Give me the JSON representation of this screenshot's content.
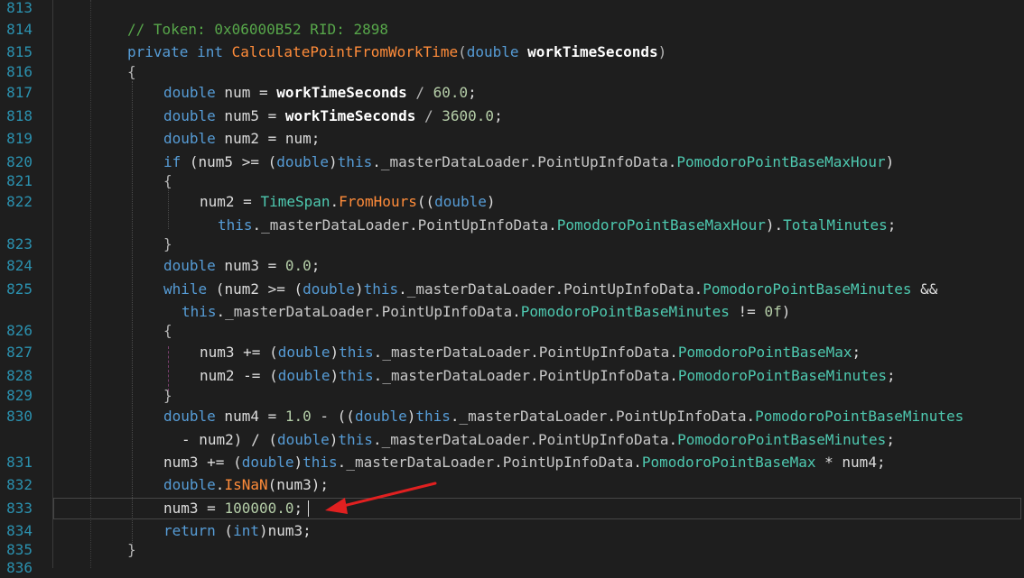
{
  "editor": {
    "line_numbers": [
      "813",
      "814",
      "815",
      "816",
      "817",
      "818",
      "819",
      "820",
      "821",
      "822",
      "823",
      "824",
      "825",
      "826",
      "827",
      "828",
      "829",
      "830",
      "831",
      "832",
      "833",
      "834",
      "835",
      "836"
    ],
    "current_line": "833",
    "colors": {
      "background": "#1e1e1e",
      "line_number": "#2b91af",
      "keyword": "#569cd6",
      "comment": "#57a64a",
      "type": "#4ec9b0",
      "method": "#ff8c3a",
      "annotation_arrow": "#e02020"
    },
    "annotation": {
      "icon": "red-arrow-icon"
    },
    "lines": [
      {
        "tokens": [
          {
            "t": "// Token: 0x06000B52 RID: 2898",
            "c": "cm"
          }
        ]
      },
      {
        "tokens": [
          {
            "t": "private",
            "c": "kw"
          },
          {
            "t": " ",
            "c": ""
          },
          {
            "t": "int",
            "c": "kw"
          },
          {
            "t": " ",
            "c": ""
          },
          {
            "t": "CalculatePointFromWorkTime",
            "c": "fn"
          },
          {
            "t": "(",
            "c": "op"
          },
          {
            "t": "double",
            "c": "kw"
          },
          {
            "t": " ",
            "c": ""
          },
          {
            "t": "workTimeSeconds",
            "c": "pa"
          },
          {
            "t": ")",
            "c": "op"
          }
        ]
      },
      {
        "tokens": [
          {
            "t": "{",
            "c": "op"
          }
        ]
      },
      {
        "tokens": [
          {
            "t": "double",
            "c": "kw"
          },
          {
            "t": " num = ",
            "c": ""
          },
          {
            "t": "workTimeSeconds",
            "c": "pa"
          },
          {
            "t": " / ",
            "c": "op"
          },
          {
            "t": "60.0",
            "c": "nu"
          },
          {
            "t": ";",
            "c": ""
          }
        ]
      },
      {
        "tokens": [
          {
            "t": "double",
            "c": "kw"
          },
          {
            "t": " num5 = ",
            "c": ""
          },
          {
            "t": "workTimeSeconds",
            "c": "pa"
          },
          {
            "t": " / ",
            "c": "op"
          },
          {
            "t": "3600.0",
            "c": "nu"
          },
          {
            "t": ";",
            "c": ""
          }
        ]
      },
      {
        "tokens": [
          {
            "t": "double",
            "c": "kw"
          },
          {
            "t": " num2 = num;",
            "c": ""
          }
        ]
      },
      {
        "tokens": [
          {
            "t": "if",
            "c": "kw"
          },
          {
            "t": " (num5 >= (",
            "c": ""
          },
          {
            "t": "double",
            "c": "kw"
          },
          {
            "t": ")",
            "c": ""
          },
          {
            "t": "this",
            "c": "kw"
          },
          {
            "t": ".",
            "c": ""
          },
          {
            "t": "_masterDataLoader",
            "c": "fd"
          },
          {
            "t": ".",
            "c": ""
          },
          {
            "t": "PointUpInfoData",
            "c": "fd"
          },
          {
            "t": ".",
            "c": ""
          },
          {
            "t": "PomodoroPointBaseMaxHour",
            "c": "pr"
          },
          {
            "t": ")",
            "c": ""
          }
        ]
      },
      {
        "tokens": [
          {
            "t": "{",
            "c": "op"
          }
        ]
      },
      {
        "tokens": [
          {
            "t": "num2 = ",
            "c": ""
          },
          {
            "t": "TimeSpan",
            "c": "ty"
          },
          {
            "t": ".",
            "c": ""
          },
          {
            "t": "FromHours",
            "c": "fn"
          },
          {
            "t": "((",
            "c": ""
          },
          {
            "t": "double",
            "c": "kw"
          },
          {
            "t": ")",
            "c": ""
          }
        ]
      },
      {
        "tokens": [
          {
            "t": "this",
            "c": "kw"
          },
          {
            "t": ".",
            "c": ""
          },
          {
            "t": "_masterDataLoader",
            "c": "fd"
          },
          {
            "t": ".",
            "c": ""
          },
          {
            "t": "PointUpInfoData",
            "c": "fd"
          },
          {
            "t": ".",
            "c": ""
          },
          {
            "t": "PomodoroPointBaseMaxHour",
            "c": "pr"
          },
          {
            "t": ").",
            "c": ""
          },
          {
            "t": "TotalMinutes",
            "c": "pr"
          },
          {
            "t": ";",
            "c": ""
          }
        ]
      },
      {
        "tokens": [
          {
            "t": "}",
            "c": "op"
          }
        ]
      },
      {
        "tokens": [
          {
            "t": "double",
            "c": "kw"
          },
          {
            "t": " num3 = ",
            "c": ""
          },
          {
            "t": "0.0",
            "c": "nu"
          },
          {
            "t": ";",
            "c": ""
          }
        ]
      },
      {
        "tokens": [
          {
            "t": "while",
            "c": "kw"
          },
          {
            "t": " (num2 >= (",
            "c": ""
          },
          {
            "t": "double",
            "c": "kw"
          },
          {
            "t": ")",
            "c": ""
          },
          {
            "t": "this",
            "c": "kw"
          },
          {
            "t": ".",
            "c": ""
          },
          {
            "t": "_masterDataLoader",
            "c": "fd"
          },
          {
            "t": ".",
            "c": ""
          },
          {
            "t": "PointUpInfoData",
            "c": "fd"
          },
          {
            "t": ".",
            "c": ""
          },
          {
            "t": "PomodoroPointBaseMinutes",
            "c": "pr"
          },
          {
            "t": " &&",
            "c": ""
          }
        ]
      },
      {
        "tokens": [
          {
            "t": "this",
            "c": "kw"
          },
          {
            "t": ".",
            "c": ""
          },
          {
            "t": "_masterDataLoader",
            "c": "fd"
          },
          {
            "t": ".",
            "c": ""
          },
          {
            "t": "PointUpInfoData",
            "c": "fd"
          },
          {
            "t": ".",
            "c": ""
          },
          {
            "t": "PomodoroPointBaseMinutes",
            "c": "pr"
          },
          {
            "t": " != ",
            "c": ""
          },
          {
            "t": "0f",
            "c": "nu"
          },
          {
            "t": ")",
            "c": ""
          }
        ]
      },
      {
        "tokens": [
          {
            "t": "{",
            "c": "op"
          }
        ]
      },
      {
        "tokens": [
          {
            "t": "num3 += (",
            "c": ""
          },
          {
            "t": "double",
            "c": "kw"
          },
          {
            "t": ")",
            "c": ""
          },
          {
            "t": "this",
            "c": "kw"
          },
          {
            "t": ".",
            "c": ""
          },
          {
            "t": "_masterDataLoader",
            "c": "fd"
          },
          {
            "t": ".",
            "c": ""
          },
          {
            "t": "PointUpInfoData",
            "c": "fd"
          },
          {
            "t": ".",
            "c": ""
          },
          {
            "t": "PomodoroPointBaseMax",
            "c": "pr"
          },
          {
            "t": ";",
            "c": ""
          }
        ]
      },
      {
        "tokens": [
          {
            "t": "num2 -= (",
            "c": ""
          },
          {
            "t": "double",
            "c": "kw"
          },
          {
            "t": ")",
            "c": ""
          },
          {
            "t": "this",
            "c": "kw"
          },
          {
            "t": ".",
            "c": ""
          },
          {
            "t": "_masterDataLoader",
            "c": "fd"
          },
          {
            "t": ".",
            "c": ""
          },
          {
            "t": "PointUpInfoData",
            "c": "fd"
          },
          {
            "t": ".",
            "c": ""
          },
          {
            "t": "PomodoroPointBaseMinutes",
            "c": "pr"
          },
          {
            "t": ";",
            "c": ""
          }
        ]
      },
      {
        "tokens": [
          {
            "t": "}",
            "c": "op"
          }
        ]
      },
      {
        "tokens": [
          {
            "t": "double",
            "c": "kw"
          },
          {
            "t": " num4 = ",
            "c": ""
          },
          {
            "t": "1.0",
            "c": "nu"
          },
          {
            "t": " - ((",
            "c": ""
          },
          {
            "t": "double",
            "c": "kw"
          },
          {
            "t": ")",
            "c": ""
          },
          {
            "t": "this",
            "c": "kw"
          },
          {
            "t": ".",
            "c": ""
          },
          {
            "t": "_masterDataLoader",
            "c": "fd"
          },
          {
            "t": ".",
            "c": ""
          },
          {
            "t": "PointUpInfoData",
            "c": "fd"
          },
          {
            "t": ".",
            "c": ""
          },
          {
            "t": "PomodoroPointBaseMinutes",
            "c": "pr"
          }
        ]
      },
      {
        "tokens": [
          {
            "t": "- num2) / (",
            "c": ""
          },
          {
            "t": "double",
            "c": "kw"
          },
          {
            "t": ")",
            "c": ""
          },
          {
            "t": "this",
            "c": "kw"
          },
          {
            "t": ".",
            "c": ""
          },
          {
            "t": "_masterDataLoader",
            "c": "fd"
          },
          {
            "t": ".",
            "c": ""
          },
          {
            "t": "PointUpInfoData",
            "c": "fd"
          },
          {
            "t": ".",
            "c": ""
          },
          {
            "t": "PomodoroPointBaseMinutes",
            "c": "pr"
          },
          {
            "t": ";",
            "c": ""
          }
        ]
      },
      {
        "tokens": [
          {
            "t": "num3 += (",
            "c": ""
          },
          {
            "t": "double",
            "c": "kw"
          },
          {
            "t": ")",
            "c": ""
          },
          {
            "t": "this",
            "c": "kw"
          },
          {
            "t": ".",
            "c": ""
          },
          {
            "t": "_masterDataLoader",
            "c": "fd"
          },
          {
            "t": ".",
            "c": ""
          },
          {
            "t": "PointUpInfoData",
            "c": "fd"
          },
          {
            "t": ".",
            "c": ""
          },
          {
            "t": "PomodoroPointBaseMax",
            "c": "pr"
          },
          {
            "t": " * num4;",
            "c": ""
          }
        ]
      },
      {
        "tokens": [
          {
            "t": "double",
            "c": "kw"
          },
          {
            "t": ".",
            "c": ""
          },
          {
            "t": "IsNaN",
            "c": "fn"
          },
          {
            "t": "(num3);",
            "c": ""
          }
        ]
      },
      {
        "tokens": [
          {
            "t": "num3 = ",
            "c": ""
          },
          {
            "t": "100000.0",
            "c": "nu"
          },
          {
            "t": ";",
            "c": ""
          }
        ]
      },
      {
        "tokens": [
          {
            "t": "return",
            "c": "kw"
          },
          {
            "t": " (",
            "c": ""
          },
          {
            "t": "int",
            "c": "kw"
          },
          {
            "t": ")num3;",
            "c": ""
          }
        ]
      },
      {
        "tokens": [
          {
            "t": "}",
            "c": "op"
          }
        ]
      }
    ]
  }
}
